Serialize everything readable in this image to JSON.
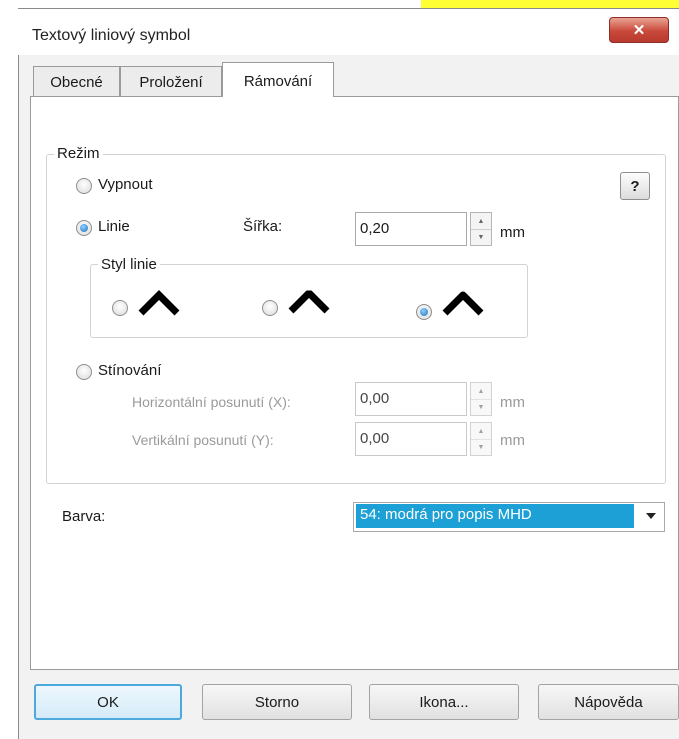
{
  "window": {
    "title": "Textový liniový symbol",
    "close_glyph": "✕"
  },
  "tabs": [
    {
      "label": "Obecné",
      "active": false
    },
    {
      "label": "Proložení",
      "active": false
    },
    {
      "label": "Rámování",
      "active": true
    }
  ],
  "mode": {
    "group_label": "Režim",
    "help_label": "?",
    "options": [
      {
        "label": "Vypnout",
        "checked": false
      },
      {
        "label": "Linie",
        "checked": true
      },
      {
        "label": "Stínování",
        "checked": false
      }
    ]
  },
  "line": {
    "width_label": "Šířka:",
    "width_value": "0,20",
    "width_unit": "mm",
    "style_group_label": "Styl linie",
    "style_options": [
      {
        "icon": "chevron-up-miter-icon",
        "checked": false
      },
      {
        "icon": "chevron-up-bevel-icon",
        "checked": false
      },
      {
        "icon": "chevron-up-round-icon",
        "checked": true
      }
    ]
  },
  "shading": {
    "horizontal_label": "Horizontální posunutí (X):",
    "horizontal_value": "0,00",
    "horizontal_unit": "mm",
    "vertical_label": "Vertikální posunutí (Y):",
    "vertical_value": "0,00",
    "vertical_unit": "mm"
  },
  "color": {
    "label": "Barva:",
    "selected": "54: modrá pro popis MHD",
    "highlight_color": "#1ca0d6"
  },
  "buttons": {
    "ok": "OK",
    "cancel": "Storno",
    "icon": "Ikona...",
    "help": "Nápověda"
  }
}
